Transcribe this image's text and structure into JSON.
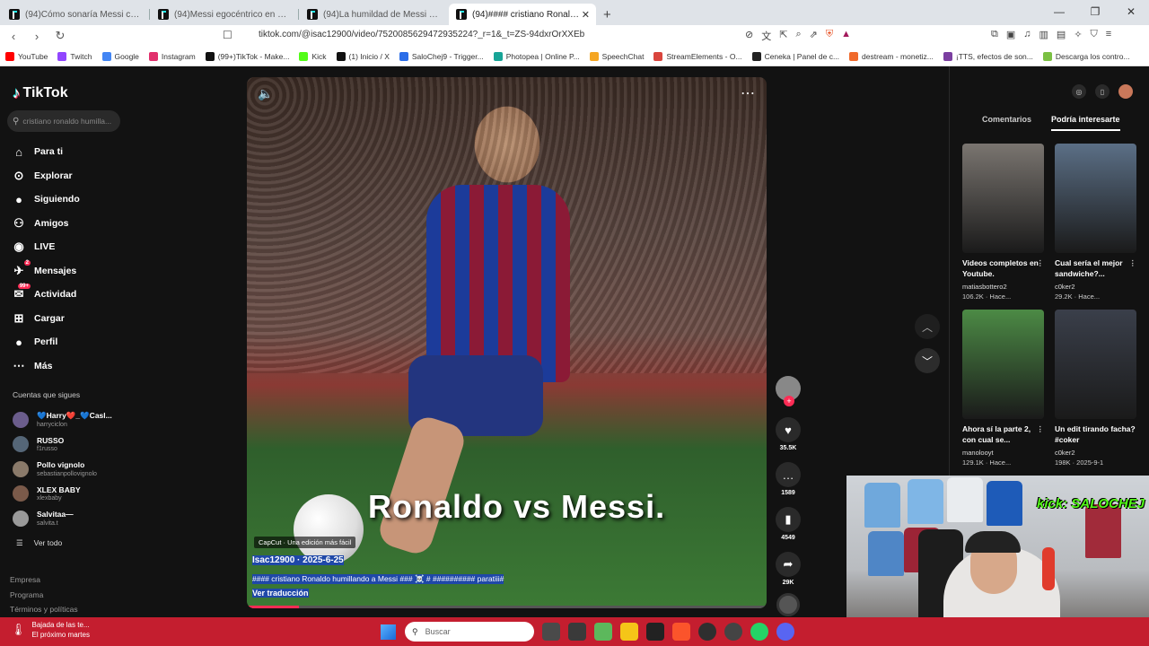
{
  "browser": {
    "tabs": [
      {
        "title": "(94)Cómo sonaría Messi con un eg..."
      },
      {
        "title": "(94)Messi egocéntrico en Qatar 2022..."
      },
      {
        "title": "(94)La humildad de Messi en el fútb..."
      },
      {
        "title": "(94)#### cristiano Ronaldo h...",
        "active": true
      }
    ],
    "url": "tiktok.com/@isac12900/video/7520085629472935224?_r=1&_t=ZS-94dxrOrXXEb",
    "bookmarks": [
      {
        "label": "YouTube",
        "color": "#ff0000"
      },
      {
        "label": "Twitch",
        "color": "#9146ff"
      },
      {
        "label": "Google",
        "color": "#4285f4"
      },
      {
        "label": "Instagram",
        "color": "#e1306c"
      },
      {
        "label": "(99+)TikTok - Make...",
        "color": "#111111"
      },
      {
        "label": "Kick",
        "color": "#53fc18"
      },
      {
        "label": "(1) Inicio / X",
        "color": "#111111"
      },
      {
        "label": "SaloChej9 - Trigger...",
        "color": "#2b6de8"
      },
      {
        "label": "Photopea | Online P...",
        "color": "#18a497"
      },
      {
        "label": "SpeechChat",
        "color": "#f5a623"
      },
      {
        "label": "StreamElements - O...",
        "color": "#d9453d"
      },
      {
        "label": "Ceneka | Panel de c...",
        "color": "#222222"
      },
      {
        "label": "destream - monetiz...",
        "color": "#f06a2c"
      },
      {
        "label": "¡TTS, efectos de son...",
        "color": "#7b3fa0"
      },
      {
        "label": "Descarga los contro...",
        "color": "#7bc043"
      }
    ]
  },
  "sidebar": {
    "logo": "TikTok",
    "search_placeholder": "cristiano ronaldo humilla...",
    "menu": [
      {
        "label": "Para ti",
        "icon": "home-icon"
      },
      {
        "label": "Explorar",
        "icon": "compass-icon"
      },
      {
        "label": "Siguiendo",
        "icon": "following-icon"
      },
      {
        "label": "Amigos",
        "icon": "friends-icon"
      },
      {
        "label": "LIVE",
        "icon": "live-icon"
      },
      {
        "label": "Mensajes",
        "icon": "messages-icon",
        "badge": "2"
      },
      {
        "label": "Actividad",
        "icon": "activity-icon",
        "badge": "99+"
      },
      {
        "label": "Cargar",
        "icon": "upload-icon"
      },
      {
        "label": "Perfil",
        "icon": "profile-icon"
      },
      {
        "label": "Más",
        "icon": "more-icon"
      }
    ],
    "following_title": "Cuentas que sigues",
    "following": [
      {
        "name": "💙Harry❤️_💙Casl...",
        "handle": "harryciclon"
      },
      {
        "name": "RUSSO",
        "handle": "f1russo"
      },
      {
        "name": "Pollo vignolo",
        "handle": "sebastianpollovignolo"
      },
      {
        "name": "XLEX BABY",
        "handle": "xlexbaby"
      },
      {
        "name": "Salvitaa—",
        "handle": "salvita.t"
      }
    ],
    "see_all": "Ver todo",
    "footer": [
      "Empresa",
      "Programa",
      "Términos y políticas"
    ]
  },
  "video": {
    "overlay_text": "Ronaldo vs Messi.",
    "capcut": "CapCut · Una edición más fácil",
    "author_line": "Isac12900 · 2025-6-25",
    "caption": "#### cristiano Ronaldo humillando a Messi ### ☠️ # ########## paratiii#",
    "translate": "Ver traducción",
    "progress": 0.1
  },
  "actions": {
    "likes": "35.5K",
    "comments": "1589",
    "saves": "4549",
    "shares": "29K"
  },
  "right_panel": {
    "tabs": [
      "Comentarios",
      "Podría interesarte"
    ],
    "active_tab": 1,
    "cards": [
      {
        "title": "Videos completos en Youtube.",
        "author": "matiasbottero2",
        "stats": "106.2K · Hace...",
        "color": "#7a7570"
      },
      {
        "title": "Cual sería el mejor sandwiche?...",
        "author": "c0ker2",
        "stats": "29.2K · Hace...",
        "color": "#5b6f86"
      },
      {
        "title": "Ahora sí la parte 2, con cual se...",
        "author": "manolooyt",
        "stats": "129.1K · Hace...",
        "color": "#4c8a45"
      },
      {
        "title": "Un edit tirando facha? #coker",
        "author": "c0ker2",
        "stats": "198K · 2025-9-1",
        "color": "#3a3f4a"
      }
    ]
  },
  "webcam": {
    "overlay": "kick: SALOCHEJ"
  },
  "taskbar": {
    "weather_title": "Bajada de las te...",
    "weather_sub": "El próximo martes",
    "search": "Buscar"
  }
}
